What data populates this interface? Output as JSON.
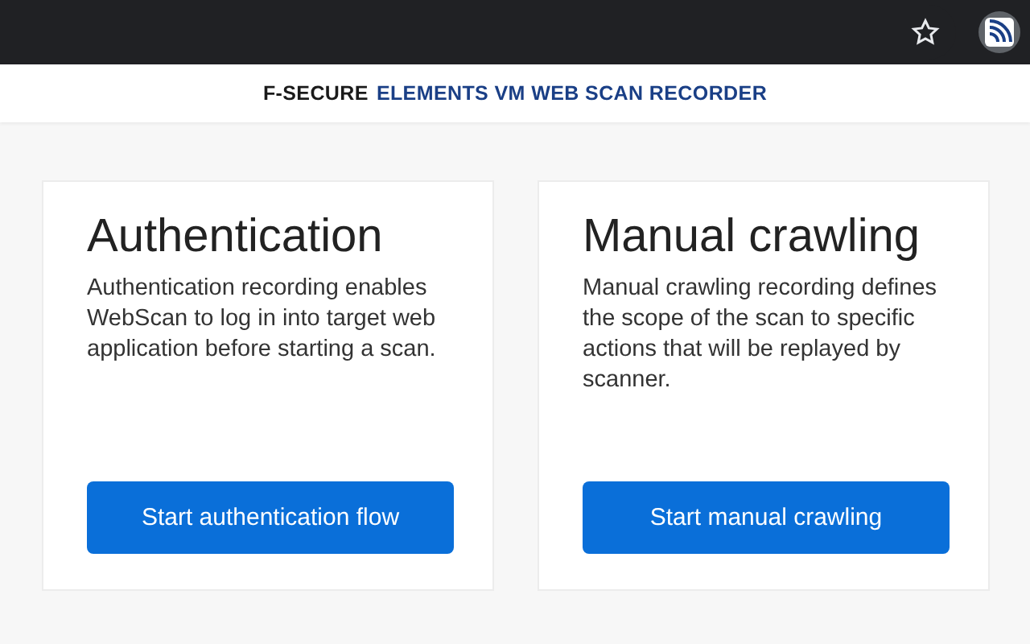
{
  "header": {
    "brand": "F-SECURE",
    "product": "ELEMENTS VM WEB SCAN RECORDER"
  },
  "cards": [
    {
      "title": "Authentication",
      "description": "Authentication recording enables WebScan to log in into target web application before starting a scan.",
      "button": "Start authentication flow"
    },
    {
      "title": "Manual crawling",
      "description": "Manual crawling recording defines the scope of the scan to specific actions that will be replayed by scanner.",
      "button": "Start manual crawling"
    }
  ]
}
